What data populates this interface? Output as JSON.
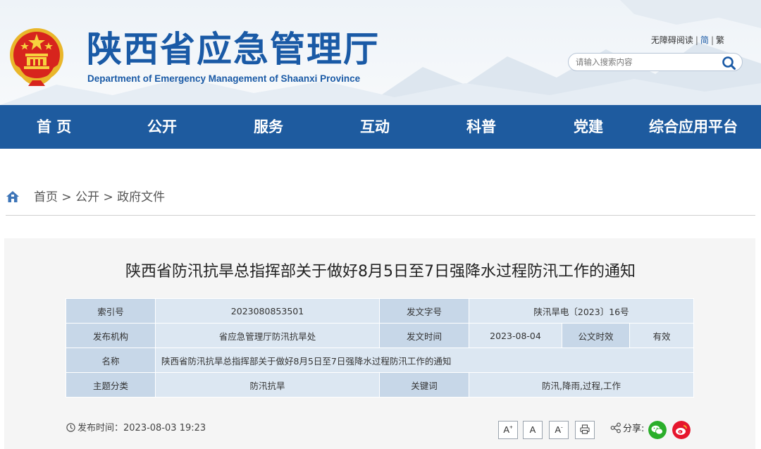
{
  "header": {
    "title_cn": "陕西省应急管理厅",
    "title_en": "Department of Emergency Management of Shaanxi Province",
    "links": {
      "accessible": "无障碍阅读",
      "simplified": "简",
      "traditional": "繁"
    },
    "search": {
      "placeholder": "请输入搜索内容",
      "value": ""
    }
  },
  "nav": {
    "items": [
      {
        "label": "首 页"
      },
      {
        "label": "公开"
      },
      {
        "label": "服务"
      },
      {
        "label": "互动"
      },
      {
        "label": "科普"
      },
      {
        "label": "党建"
      },
      {
        "label": "综合应用平台"
      }
    ]
  },
  "breadcrumb": {
    "items": [
      "首页",
      "公开",
      "政府文件"
    ],
    "separator": ">"
  },
  "article": {
    "title": "陕西省防汛抗旱总指挥部关于做好8月5日至7日强降水过程防汛工作的通知",
    "meta": {
      "index_label": "索引号",
      "index_value": "2023080853501",
      "docno_label": "发文字号",
      "docno_value": "陕汛旱电〔2023〕16号",
      "org_label": "发布机构",
      "org_value": "省应急管理厅防汛抗旱处",
      "date_label": "发文时间",
      "date_value": "2023-08-04",
      "validity_label": "公文时效",
      "validity_value": "有效",
      "name_label": "名称",
      "name_value": "陕西省防汛抗旱总指挥部关于做好8月5日至7日强降水过程防汛工作的通知",
      "topic_label": "主题分类",
      "topic_value": "防汛抗旱",
      "keywords_label": "关键词",
      "keywords_value": "防汛,降雨,过程,工作"
    },
    "publish_label": "发布时间：",
    "publish_time": "2023-08-03 19:23",
    "font_controls": {
      "larger": "A",
      "normal": "A",
      "smaller": "A"
    },
    "share_label": "分享:"
  },
  "colors": {
    "brand_blue": "#1a5aa6",
    "nav_bg": "#1e5b9f",
    "meta_key_bg": "#c7d7e8",
    "meta_value_bg": "#dce7f2",
    "wechat": "#2aae2a",
    "weibo": "#e6162d"
  },
  "icons": [
    "national-emblem-icon",
    "search-icon",
    "home-icon",
    "clock-icon",
    "print-icon",
    "share-icon",
    "wechat-icon",
    "weibo-icon"
  ]
}
